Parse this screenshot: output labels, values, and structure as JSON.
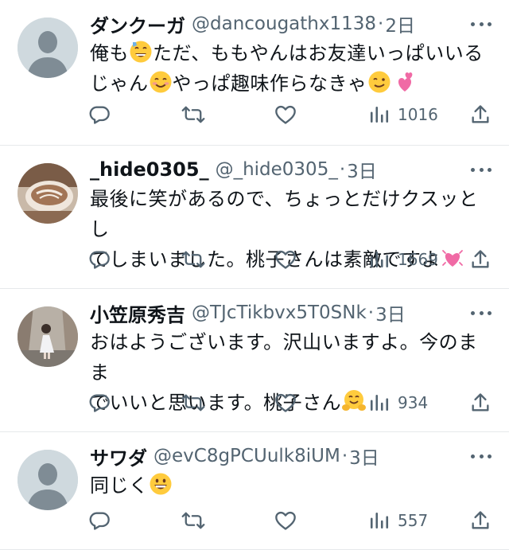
{
  "tweets": [
    {
      "name": "ダンクーガ",
      "handle": "@dancougathx1138",
      "separator": "·",
      "time": "2日",
      "line1_a": "俺も",
      "line1_b": "ただ、ももやんはお友達いっぱいいる",
      "line2_a": "じゃん",
      "line2_b": "やっぱ趣味作らなきゃ",
      "views": "1016",
      "avatar": "default"
    },
    {
      "name": "_hide0305_",
      "handle": "@_hide0305_",
      "separator": "·",
      "time": "3日",
      "line1": "最後に笑があるので、ちょっとだけクスッとし",
      "line2": "てしまいました。桃子さんは素敵ですよ",
      "views": "1669",
      "avatar": "photo-cup"
    },
    {
      "name": "小笠原秀吉",
      "handle": "@TJcTikbvx5T0SNk",
      "separator": "·",
      "time": "3日",
      "line1": "おはようございます。沢山いますよ。今のまま",
      "line2": "でいいと思います。桃子さん",
      "views": "934",
      "avatar": "photo-person"
    },
    {
      "name": "サワダ",
      "handle": "@evC8gPCUulk8iUM",
      "separator": "·",
      "time": "3日",
      "line1": "同じく",
      "views": "557",
      "avatar": "default"
    }
  ],
  "icons": {
    "reply": "reply-icon",
    "retweet": "retweet-icon",
    "like": "like-icon",
    "views": "views-icon",
    "share": "share-icon",
    "more": "more-icon"
  },
  "colors": {
    "text": "#0f1419",
    "secondary": "#536471",
    "divider": "#e6e9eb",
    "default_avatar": "#cfd9de"
  }
}
